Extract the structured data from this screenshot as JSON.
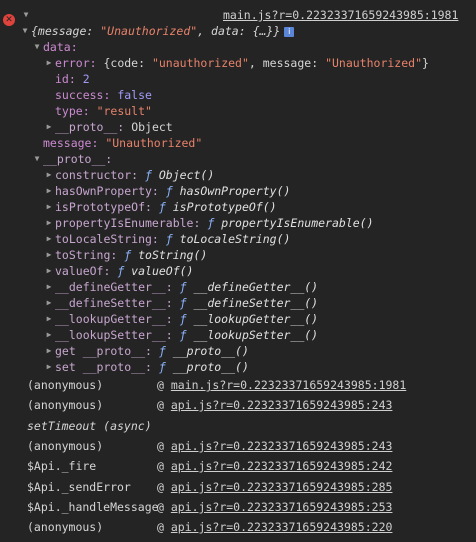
{
  "header": {
    "source_link": "main.js?r=0.22323371659243985:1981"
  },
  "object_summary": {
    "open": "{message: ",
    "message": "\"Unauthorized\"",
    "mid": ", data: {…}}"
  },
  "data_section": {
    "label": "data:",
    "error_key": "error:",
    "error_open": "{code: ",
    "error_code": "\"unauthorized\"",
    "error_mid": ", message: ",
    "error_message": "\"Unauthorized\"",
    "error_close": "}",
    "id_key": "id:",
    "id_val": "2",
    "success_key": "success:",
    "success_val": "false",
    "type_key": "type:",
    "type_val": "\"result\"",
    "proto_key": "__proto__:",
    "proto_val": "Object"
  },
  "message_row": {
    "key": "message:",
    "val": "\"Unauthorized\""
  },
  "proto_section": {
    "label": "__proto__:",
    "items": [
      {
        "key": "constructor:",
        "fn": "Object()"
      },
      {
        "key": "hasOwnProperty:",
        "fn": "hasOwnProperty()"
      },
      {
        "key": "isPrototypeOf:",
        "fn": "isPrototypeOf()"
      },
      {
        "key": "propertyIsEnumerable:",
        "fn": "propertyIsEnumerable()"
      },
      {
        "key": "toLocaleString:",
        "fn": "toLocaleString()"
      },
      {
        "key": "toString:",
        "fn": "toString()"
      },
      {
        "key": "valueOf:",
        "fn": "valueOf()"
      },
      {
        "key": "__defineGetter__:",
        "fn": "__defineGetter__()"
      },
      {
        "key": "__defineSetter__:",
        "fn": "__defineSetter__()"
      },
      {
        "key": "__lookupGetter__:",
        "fn": "__lookupGetter__()"
      },
      {
        "key": "__lookupSetter__:",
        "fn": "__lookupSetter__()"
      },
      {
        "key": "get __proto__:",
        "fn": "__proto__()"
      },
      {
        "key": "set __proto__:",
        "fn": "__proto__()"
      }
    ],
    "f_glyph": "ƒ"
  },
  "stack": {
    "at": "@",
    "async_label": "setTimeout (async)",
    "frames": [
      {
        "fn": "(anonymous)",
        "link": "main.js?r=0.22323371659243985:1981"
      },
      {
        "fn": "(anonymous)",
        "link": "api.js?r=0.22323371659243985:243"
      },
      {
        "fn": "(anonymous)",
        "link": "api.js?r=0.22323371659243985:243"
      },
      {
        "fn": "$Api._fire",
        "link": "api.js?r=0.22323371659243985:242"
      },
      {
        "fn": "$Api._sendError",
        "link": "api.js?r=0.22323371659243985:285"
      },
      {
        "fn": "$Api._handleMessage",
        "link": "api.js?r=0.22323371659243985:253"
      },
      {
        "fn": "(anonymous)",
        "link": "api.js?r=0.22323371659243985:220"
      }
    ]
  },
  "colors": {
    "background": "#242424",
    "error_icon": "#e0433c",
    "key": "#cb8ad0",
    "string": "#e6826a",
    "number": "#a19bf5",
    "function_keyword": "#8ab2f9"
  }
}
